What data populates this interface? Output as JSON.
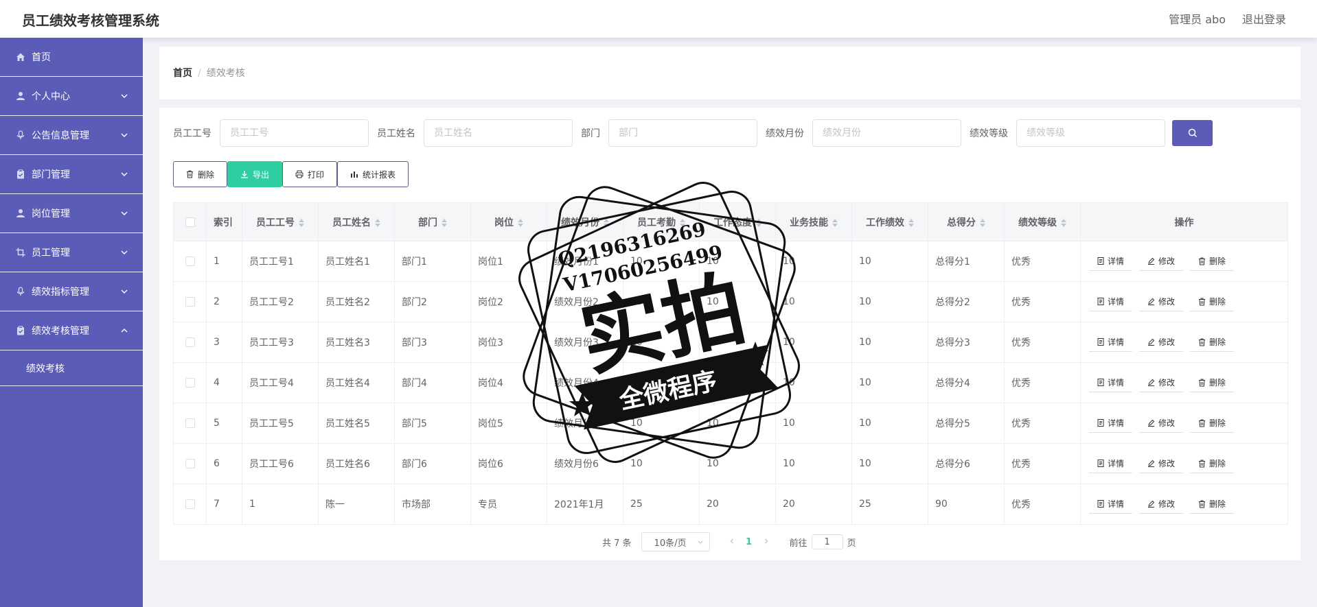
{
  "header": {
    "title": "员工绩效考核管理系统",
    "user": "管理员 abo",
    "logout": "退出登录"
  },
  "sidebar": {
    "items": [
      {
        "label": "首页",
        "icon": "home-icon"
      },
      {
        "label": "个人中心",
        "icon": "user-icon"
      },
      {
        "label": "公告信息管理",
        "icon": "mic-icon"
      },
      {
        "label": "部门管理",
        "icon": "clipboard-icon"
      },
      {
        "label": "岗位管理",
        "icon": "user-icon"
      },
      {
        "label": "员工管理",
        "icon": "crop-icon"
      },
      {
        "label": "绩效指标管理",
        "icon": "mic-icon"
      },
      {
        "label": "绩效考核管理",
        "icon": "clipboard-icon"
      }
    ],
    "sub_item": "绩效考核"
  },
  "breadcrumb": {
    "home": "首页",
    "sep": "/",
    "current": "绩效考核"
  },
  "search": {
    "fields": [
      {
        "label": "员工工号",
        "placeholder": "员工工号"
      },
      {
        "label": "员工姓名",
        "placeholder": "员工姓名"
      },
      {
        "label": "部门",
        "placeholder": "部门"
      },
      {
        "label": "绩效月份",
        "placeholder": "绩效月份"
      },
      {
        "label": "绩效等级",
        "placeholder": "绩效等级"
      }
    ]
  },
  "toolbar": {
    "delete": "删除",
    "export": "导出",
    "print": "打印",
    "report": "统计报表"
  },
  "table": {
    "headers": [
      "索引",
      "员工工号",
      "员工姓名",
      "部门",
      "岗位",
      "绩效月份",
      "员工考勤",
      "工作态度",
      "业务技能",
      "工作绩效",
      "总得分",
      "绩效等级",
      "操作"
    ],
    "rows": [
      [
        "1",
        "员工工号1",
        "员工姓名1",
        "部门1",
        "岗位1",
        "绩效月份1",
        "10",
        "10",
        "10",
        "10",
        "总得分1",
        "优秀"
      ],
      [
        "2",
        "员工工号2",
        "员工姓名2",
        "部门2",
        "岗位2",
        "绩效月份2",
        "10",
        "10",
        "10",
        "10",
        "总得分2",
        "优秀"
      ],
      [
        "3",
        "员工工号3",
        "员工姓名3",
        "部门3",
        "岗位3",
        "绩效月份3",
        "10",
        "10",
        "10",
        "10",
        "总得分3",
        "优秀"
      ],
      [
        "4",
        "员工工号4",
        "员工姓名4",
        "部门4",
        "岗位4",
        "绩效月份4",
        "10",
        "10",
        "10",
        "10",
        "总得分4",
        "优秀"
      ],
      [
        "5",
        "员工工号5",
        "员工姓名5",
        "部门5",
        "岗位5",
        "绩效月份5",
        "10",
        "10",
        "10",
        "10",
        "总得分5",
        "优秀"
      ],
      [
        "6",
        "员工工号6",
        "员工姓名6",
        "部门6",
        "岗位6",
        "绩效月份6",
        "10",
        "10",
        "10",
        "10",
        "总得分6",
        "优秀"
      ],
      [
        "7",
        "1",
        "陈一",
        "市场部",
        "专员",
        "2021年1月",
        "25",
        "20",
        "20",
        "25",
        "90",
        "优秀"
      ]
    ],
    "ops": {
      "detail": "详情",
      "edit": "修改",
      "delete": "删除"
    }
  },
  "pagination": {
    "total": "共 7 条",
    "page_size": "10条/页",
    "current": "1",
    "goto_label": "前往",
    "goto_value": "1",
    "page_suffix": "页"
  },
  "watermark": {
    "line1": "Q2196316269",
    "line2": "V17060256499",
    "main": "实拍",
    "banner": "全微程序"
  },
  "colors": {
    "sidebar": "#5b5bb8",
    "accent": "#2fcea0",
    "search_button": "#5b5bb8"
  }
}
